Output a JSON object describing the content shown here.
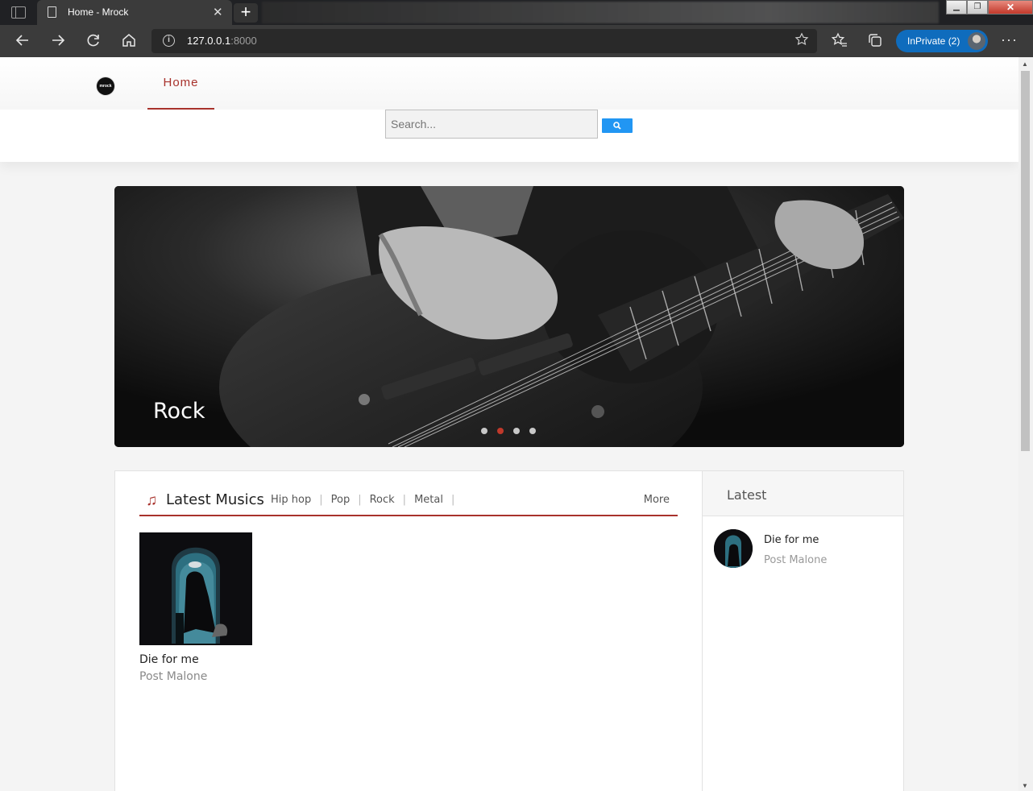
{
  "browser": {
    "tab_title": "Home - Mrock",
    "tab_close": "✕",
    "new_tab": "+",
    "url_host": "127.0.0.1",
    "url_port": ":8000",
    "inprivate_label": "InPrivate (2)",
    "more_label": "···",
    "window_controls": {
      "minimize": "▁",
      "restore": "❐",
      "close": "✕"
    }
  },
  "site": {
    "logo_text": "mrock",
    "nav": {
      "home_label": "Home"
    },
    "search": {
      "placeholder": "Search..."
    }
  },
  "carousel": {
    "caption": "Rock",
    "slide_count": 4,
    "active_slide": 2
  },
  "latest_musics": {
    "icon": "♫",
    "title": "Latest Musics",
    "categories": [
      "Hip hop",
      "Pop",
      "Rock",
      "Metal"
    ],
    "more_label": "More",
    "items": [
      {
        "title": "Die for me",
        "artist": "Post Malone"
      }
    ]
  },
  "sidebar": {
    "title": "Latest",
    "items": [
      {
        "title": "Die for me",
        "artist": "Post Malone"
      }
    ]
  },
  "colors": {
    "accent": "#a8322c",
    "search_button": "#2196f3",
    "inprivate": "#0f6cbd"
  }
}
